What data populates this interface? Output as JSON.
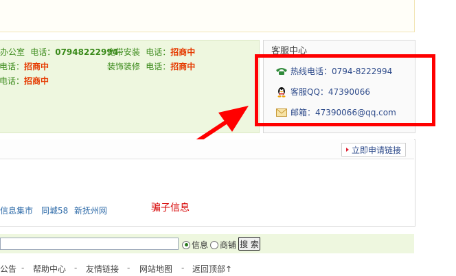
{
  "ads": {
    "row1_left_name": "办公室",
    "row1_left_tel_label": "电话：",
    "row1_left_tel": "07948222994",
    "row1_right_name": "宽带安装",
    "row1_right_tel_label": "电话：",
    "row1_right_tel": "招商中",
    "row2_left_tel_label": "电话：",
    "row2_left_tel": "招商中",
    "row2_right_name": "装饰装修",
    "row2_right_tel_label": "电话：",
    "row2_right_tel": "招商中",
    "row3_left_tel_label": "电话：",
    "row3_left_tel": "招商中"
  },
  "service": {
    "title": "客服中心",
    "hotline": "热线电话：0794-8222994",
    "qq": "客服QQ：47390066",
    "email": "邮箱：47390066@qq.com"
  },
  "links": {
    "apply_label": "立即申请链接",
    "items": [
      "信息集市",
      "同城58",
      "新抚州网"
    ]
  },
  "annotation": {
    "scam_label": "骗子信息"
  },
  "search": {
    "value": "",
    "opt_info": "信息",
    "opt_shop": "商铺",
    "button": "搜 索"
  },
  "footer": {
    "items": [
      "公告",
      "帮助中心",
      "友情链接",
      "网站地图",
      "返回顶部↑"
    ]
  },
  "colors": {
    "highlight": "#ff0000",
    "arrow": "#ff0000",
    "ad_bg": "#eef7df"
  }
}
